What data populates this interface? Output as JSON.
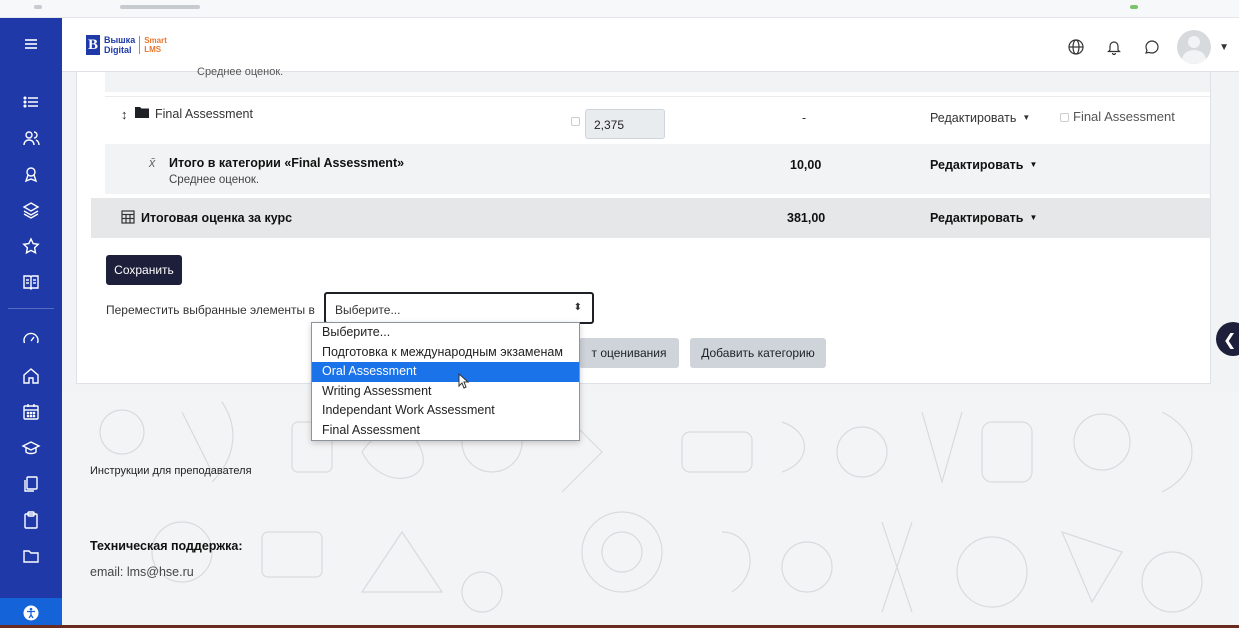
{
  "header": {
    "logo_line1": "Вышка",
    "logo_line2": "Digital",
    "logo_brand1": "Smart",
    "logo_brand2": "LMS"
  },
  "grader": {
    "cutoff_text": "Среднее оценок.",
    "rows": [
      {
        "name": "Final Assessment",
        "grade": "2,375",
        "range": "-",
        "action": "Редактировать",
        "checkbox_label": "Final Assessment"
      },
      {
        "name": "Итого в категории «Final Assessment»",
        "subtitle": "Среднее оценок.",
        "range": "10,00",
        "action": "Редактировать"
      },
      {
        "name": "Итоговая оценка за курс",
        "range": "381,00",
        "action": "Редактировать"
      }
    ]
  },
  "actions": {
    "save_label": "Сохранить",
    "move_label": "Переместить выбранные элементы в",
    "select_value": "Выберите...",
    "add_item_label": "т оценивания",
    "add_category_label": "Добавить категорию"
  },
  "dropdown": {
    "options": [
      "Выберите...",
      "Подготовка к международным экзаменам",
      "Oral Assessment",
      "Writing Assessment",
      "Independant Work Assessment",
      "Final Assessment"
    ],
    "highlighted": "Oral Assessment"
  },
  "footer": {
    "instructions_link": "Инструкции для преподавателя",
    "support_heading": "Техническая поддержка:",
    "support_email": "email: lms@hse.ru"
  },
  "colors": {
    "sidebar": "#1f3aa8",
    "accent_orange": "#e8772e",
    "save_button": "#1d1f3b",
    "highlight": "#1a73e8"
  }
}
